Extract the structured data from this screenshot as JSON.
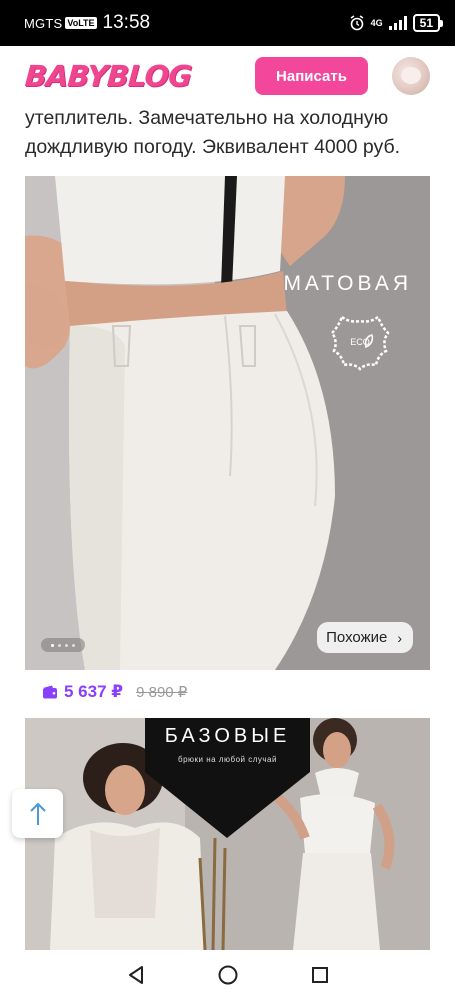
{
  "status_bar": {
    "carrier": "MGTS",
    "volte": "VoLTE",
    "time": "13:58",
    "network": "4G",
    "battery": "51",
    "icons": [
      "alarm-icon",
      "signal-icon",
      "battery-icon"
    ]
  },
  "header": {
    "logo": "BABYBLOG",
    "write_button": "Написать",
    "brand_color": "#f2479a"
  },
  "post": {
    "text": "утеплитель. Замечательно на холодную дождливую погоду. Эквивалент 4000 руб."
  },
  "product_card": {
    "overlay_label": "МАТОВАЯ",
    "eco_badge": "ECO",
    "similar_button": "Похожие",
    "carousel": {
      "total": 4,
      "active": 1
    },
    "price_current": "5 637 ₽",
    "price_old": "9 890 ₽",
    "price_color": "#8a3ffc"
  },
  "second_card": {
    "banner_title": "БАЗОВЫЕ",
    "banner_subtitle": "брюки на любой случай"
  },
  "nav": {
    "icons": [
      "back-icon",
      "home-icon",
      "recents-icon"
    ]
  }
}
